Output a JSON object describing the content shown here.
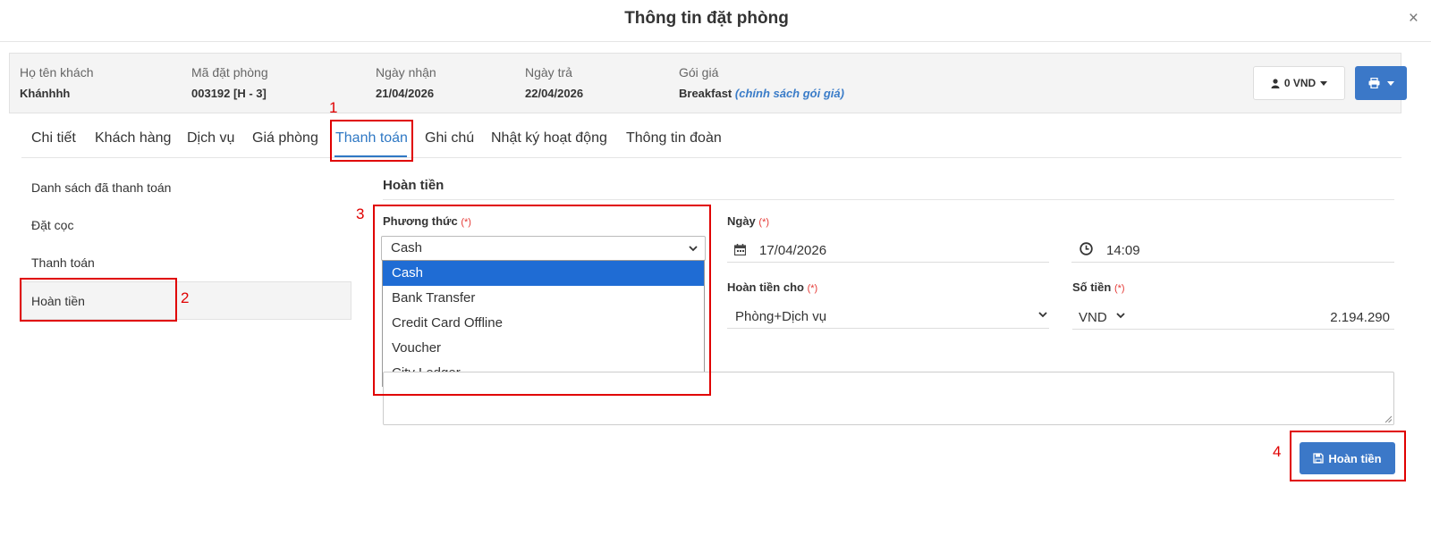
{
  "modal": {
    "title": "Thông tin đặt phòng",
    "close": "×"
  },
  "info": {
    "guest_label": "Họ tên khách",
    "guest_value": "Khánhhh",
    "code_label": "Mã đặt phòng",
    "code_value": "003192 [H - 3]",
    "checkin_label": "Ngày nhận",
    "checkin_value": "21/04/2026",
    "checkout_label": "Ngày trả",
    "checkout_value": "22/04/2026",
    "package_label": "Gói giá",
    "package_value": "Breakfast",
    "package_link": "(chính sách gói giá)",
    "balance_button": "0 VND"
  },
  "tabs": [
    {
      "label": "Chi tiết"
    },
    {
      "label": "Khách hàng"
    },
    {
      "label": "Dịch vụ"
    },
    {
      "label": "Giá phòng"
    },
    {
      "label": "Thanh toán",
      "active": true
    },
    {
      "label": "Ghi chú"
    },
    {
      "label": "Nhật ký hoạt động"
    },
    {
      "label": "Thông tin đoàn"
    }
  ],
  "side_menu": [
    {
      "label": "Danh sách đã thanh toán"
    },
    {
      "label": "Đặt cọc"
    },
    {
      "label": "Thanh toán"
    },
    {
      "label": "Hoàn tiền",
      "active": true
    }
  ],
  "form": {
    "section_title": "Hoàn tiền",
    "required_mark": "(*)",
    "method_label": "Phương thức",
    "method_value": "Cash",
    "method_options": [
      "Cash",
      "Bank Transfer",
      "Credit Card Offline",
      "Voucher",
      "City Ledger"
    ],
    "date_label": "Ngày",
    "date_value": "17/04/2026",
    "time_value": "14:09",
    "refund_for_label": "Hoàn tiền cho",
    "refund_for_value": "Phòng+Dịch vụ",
    "amount_label": "Số tiền",
    "currency_value": "VND",
    "amount_value": "2.194.290",
    "submit_label": "Hoàn tiền"
  },
  "annotations": [
    "1",
    "2",
    "3",
    "4"
  ],
  "colors": {
    "primary": "#3b78c8",
    "annotation_red": "#e00000",
    "dropdown_selected": "#1f6cd4"
  },
  "icons": [
    "close-icon",
    "user-icon",
    "caret-down-icon",
    "printer-icon",
    "calendar-icon",
    "clock-icon",
    "chevron-down-icon",
    "save-icon"
  ]
}
